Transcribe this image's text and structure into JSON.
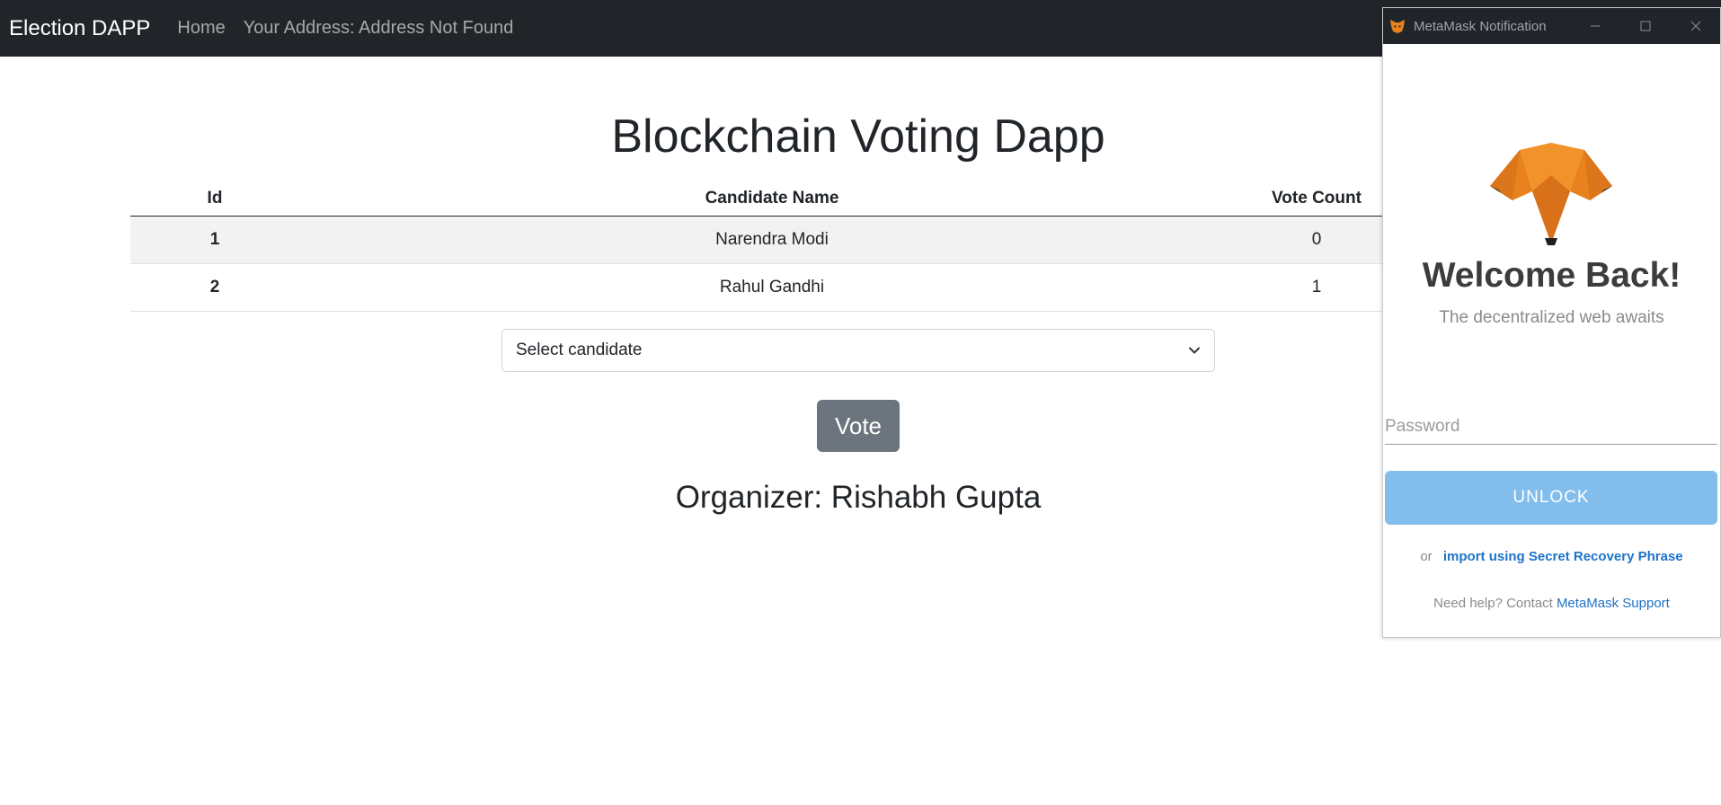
{
  "navbar": {
    "brand": "Election DAPP",
    "links": [
      "Home",
      "Your Address: Address Not Found"
    ]
  },
  "main": {
    "title": "Blockchain Voting Dapp",
    "table": {
      "headers": [
        "Id",
        "Candidate Name",
        "Vote Count"
      ],
      "rows": [
        {
          "id": "1",
          "name": "Narendra Modi",
          "count": "0"
        },
        {
          "id": "2",
          "name": "Rahul Gandhi",
          "count": "1"
        }
      ]
    },
    "select": {
      "value": "Select candidate"
    },
    "vote_label": "Vote",
    "organizer": "Organizer: Rishabh Gupta"
  },
  "metamask": {
    "window_title": "MetaMask Notification",
    "welcome": "Welcome Back!",
    "tagline": "The decentralized web awaits",
    "password_placeholder": "Password",
    "unlock_label": "UNLOCK",
    "or_text": "or",
    "import_link": "import using Secret Recovery Phrase",
    "help_text": "Need help? Contact",
    "support_link": "MetaMask Support"
  },
  "colors": {
    "navbar_bg": "#212529",
    "vote_button": "#6c757d",
    "unlock_button": "#82bdeb",
    "link_blue": "#1d73c9",
    "fox_orange": "#e8821e"
  }
}
